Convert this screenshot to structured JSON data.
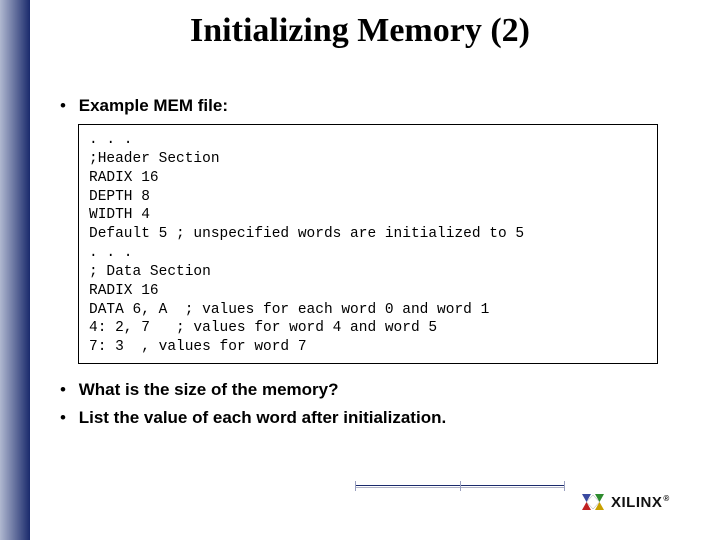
{
  "title": "Initializing Memory (2)",
  "bullets": {
    "b1": "Example MEM file:",
    "q1": "What is the size of the memory?",
    "q2": "List the value of each word after initialization."
  },
  "code_lines": {
    "l0": ". . .",
    "l1": ";Header Section",
    "l2": "RADIX 16",
    "l3": "DEPTH 8",
    "l4": "WIDTH 4",
    "l5": "Default 5 ; unspecified words are initialized to 5",
    "l6": ". . .",
    "l7": "; Data Section",
    "l8": "RADIX 16",
    "l9": "DATA 6, A  ; values for each word 0 and word 1",
    "l10": "4: 2, 7   ; values for word 4 and word 5",
    "l11": "7: 3  , values for word 7"
  },
  "logo": {
    "text": "XILINX",
    "reg": "®"
  }
}
